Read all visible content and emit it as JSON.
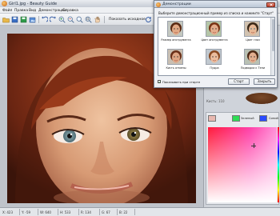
{
  "window": {
    "title": "Girl1.jpg - Beauty Guide"
  },
  "menu": [
    "Файл",
    "Правка",
    "Вид",
    "Демонстрации",
    "Справка"
  ],
  "toolbar": {
    "show_original_label": "Показать исходное"
  },
  "panel": {
    "brush_label": "Кисть: 110"
  },
  "colors": {
    "swatches": [
      {
        "label": "",
        "color": "#e8b8b0"
      },
      {
        "label": "Зеленый",
        "color": "#2fdc56"
      },
      {
        "label": "Синий",
        "color": "#2a4bff"
      }
    ],
    "accent": "#ff3fa8"
  },
  "status": {
    "x": "X: 423",
    "y": "Y: -59",
    "w": "W: 640",
    "h": "H: 533",
    "r": "R: 134",
    "g": "G: 67",
    "b": "B: 22"
  },
  "dialog": {
    "title": "Демонстрации",
    "instruction": "Выберите демонстрационный пример из списка и нажмите \"Старт\"",
    "thumbnails": [
      {
        "caption": "Размер инструмента",
        "icon": "woman-portrait-1"
      },
      {
        "caption": "Цвет инструмента",
        "icon": "woman-portrait-2"
      },
      {
        "caption": "Цвет глаз",
        "icon": "woman-portrait-3"
      },
      {
        "caption": "Кисть отмены",
        "icon": "woman-portrait-4"
      },
      {
        "caption": "Пудра",
        "icon": "woman-portrait-5"
      },
      {
        "caption": "Подводка к Тени",
        "icon": "woman-portrait-6"
      }
    ],
    "checkbox_label": "Показывать при старте",
    "checkbox_checked": true,
    "start_button": "Старт",
    "close_button": "Закрыть"
  }
}
